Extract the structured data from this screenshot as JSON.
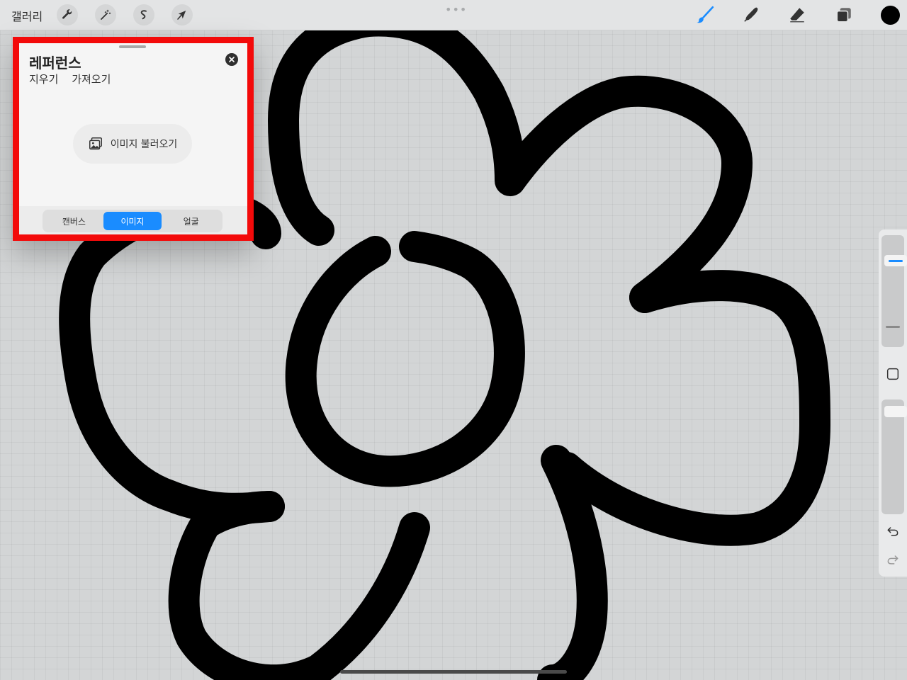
{
  "toolbar": {
    "gallery_label": "갤러리",
    "more_dots": "•••",
    "brush_color": "#1a8cff",
    "current_color": "#000000"
  },
  "reference_panel": {
    "title": "레퍼런스",
    "actions": [
      "지우기",
      "가져오기"
    ],
    "load_image_label": "이미지 불러오기",
    "tabs": [
      {
        "label": "캔버스",
        "active": false
      },
      {
        "label": "이미지",
        "active": true
      },
      {
        "label": "얼굴",
        "active": false
      }
    ],
    "highlight_color": "#f30a0a"
  },
  "sidebar": {
    "brush_size": 0.2,
    "opacity": 0.06
  }
}
